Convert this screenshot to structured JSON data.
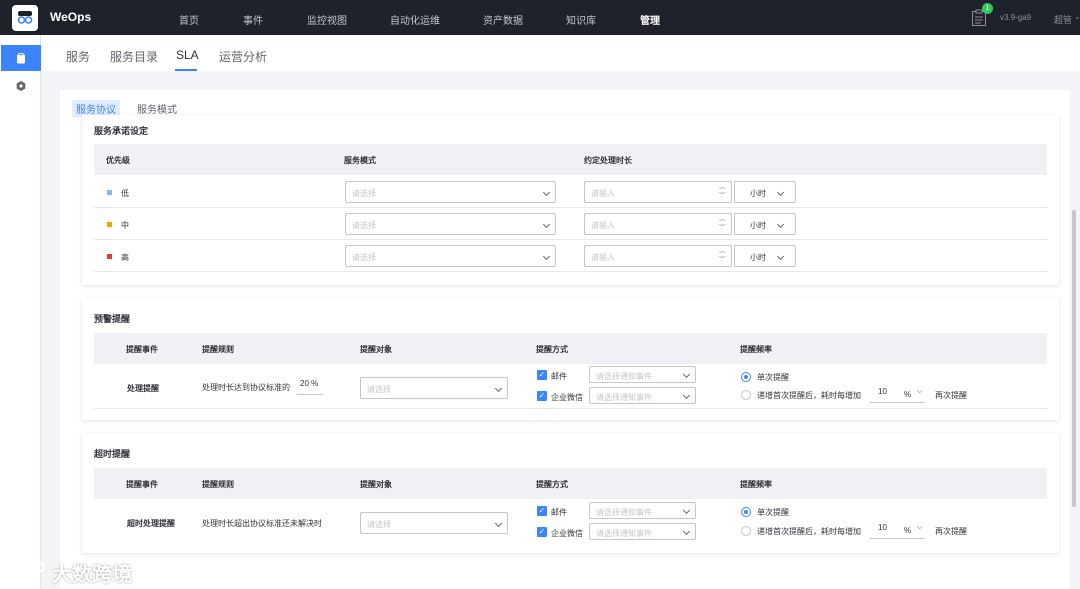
{
  "topbar": {
    "brand": "WeOps",
    "nav": [
      "首页",
      "事件",
      "监控视图",
      "自动化运维",
      "资产数据",
      "知识库",
      "管理"
    ],
    "active_nav": "管理",
    "notification_count": "1",
    "version": "v3.9-ga9",
    "user": "超管"
  },
  "subnav": {
    "tabs": [
      "服务",
      "服务目录",
      "SLA",
      "运营分析"
    ],
    "active": "SLA"
  },
  "panel_tabs": [
    "服务协议",
    "服务模式"
  ],
  "commitment": {
    "title": "服务承诺设定",
    "headers": [
      "优先级",
      "服务模式",
      "约定处理时长"
    ],
    "rows": [
      {
        "priority": "低",
        "color": "#8ab4f8",
        "mode_placeholder": "请选择",
        "time_placeholder": "请输入",
        "unit": "小时"
      },
      {
        "priority": "中",
        "color": "#ff9c01",
        "mode_placeholder": "请选择",
        "time_placeholder": "请输入",
        "unit": "小时"
      },
      {
        "priority": "高",
        "color": "#ea3636",
        "mode_placeholder": "请选择",
        "time_placeholder": "请输入",
        "unit": "小时"
      }
    ]
  },
  "warning": {
    "title": "预警提醒",
    "headers": [
      "提醒事件",
      "提醒规则",
      "提醒对象",
      "提醒方式",
      "提醒频率"
    ],
    "event": "处理提醒",
    "rule": "处理时长达到协议标准的",
    "rule_value": "20 %",
    "target_placeholder": "请选择",
    "method1": "邮件",
    "method2": "企业微信",
    "notify_placeholder": "请选择通知事件",
    "freq1": "单次提醒",
    "freq2_prefix": "递增首次提醒后，耗时每增加",
    "freq2_value": "10",
    "freq2_unit": "%",
    "freq2_suffix": "再次提醒"
  },
  "timeout": {
    "title": "超时提醒",
    "headers": [
      "提醒事件",
      "提醒规则",
      "提醒对象",
      "提醒方式",
      "提醒频率"
    ],
    "event": "超时处理提醒",
    "rule": "处理时长超出协议标准还未解决时",
    "target_placeholder": "请选择",
    "method1": "邮件",
    "method2": "企业微信",
    "notify_placeholder": "请选择通知事件",
    "freq1": "单次提醒",
    "freq2_prefix": "递增首次提醒后，耗时每增加",
    "freq2_value": "10",
    "freq2_unit": "%",
    "freq2_suffix": "再次提醒"
  },
  "watermark": "大数跨境"
}
